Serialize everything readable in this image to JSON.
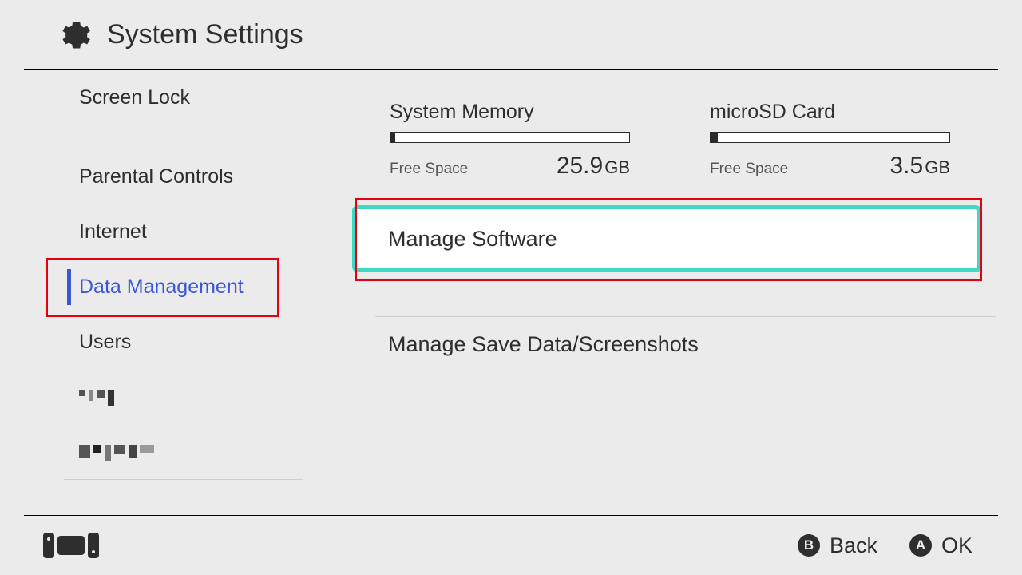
{
  "header": {
    "title": "System Settings"
  },
  "sidebar": {
    "items": [
      {
        "label": "Screen Lock",
        "selected": false
      },
      {
        "label": "Parental Controls",
        "selected": false,
        "sep_above": true
      },
      {
        "label": "Internet",
        "selected": false
      },
      {
        "label": "Data Management",
        "selected": true
      },
      {
        "label": "Users",
        "selected": false
      },
      {
        "label": "",
        "selected": false,
        "obscured": true
      },
      {
        "label": "",
        "selected": false,
        "obscured": true
      }
    ]
  },
  "storage": {
    "system": {
      "title": "System Memory",
      "free_label": "Free Space",
      "free_value": "25.9",
      "free_unit": "GB",
      "used_pct": 2
    },
    "sd": {
      "title": "microSD Card",
      "free_label": "Free Space",
      "free_value": "3.5",
      "free_unit": "GB",
      "used_pct": 3
    }
  },
  "main": {
    "items": [
      {
        "label": "Manage Software",
        "focused": true
      },
      {
        "label": "Manage Save Data/Screenshots",
        "focused": false
      }
    ]
  },
  "footer": {
    "back": {
      "glyph": "B",
      "label": "Back"
    },
    "ok": {
      "glyph": "A",
      "label": "OK"
    }
  },
  "highlights": {
    "sidebar_selected": true,
    "main_focused": true,
    "color": "#e60012"
  }
}
